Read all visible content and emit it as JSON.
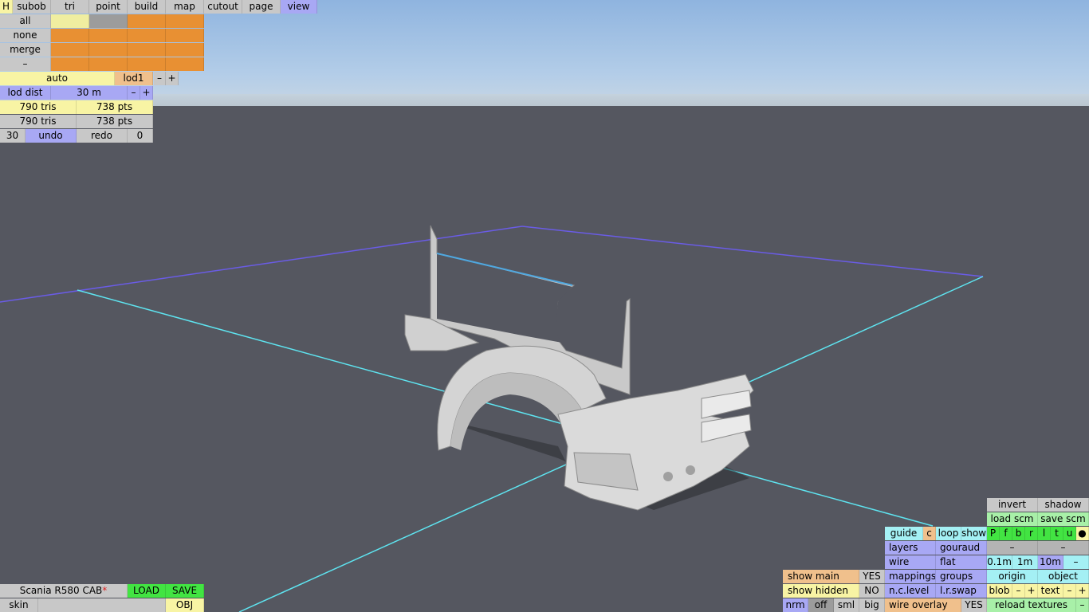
{
  "top_tabs": [
    "H",
    "subob",
    "tri",
    "point",
    "build",
    "map",
    "cutout",
    "page",
    "view"
  ],
  "select_rows": [
    "all",
    "none",
    "merge",
    "–"
  ],
  "lod": {
    "auto": "auto",
    "level": "lod1",
    "minus": "–",
    "plus": "+"
  },
  "lod_dist": {
    "label": "lod dist",
    "value": "30 m",
    "minus": "–",
    "plus": "+"
  },
  "stats": [
    {
      "tris": "790 tris",
      "pts": "738 pts"
    },
    {
      "tris": "790 tris",
      "pts": "738 pts"
    }
  ],
  "undo_row": {
    "count": "30",
    "undo": "undo",
    "redo": "redo",
    "redo_count": "0"
  },
  "file": {
    "name": "Scania R580 CAB",
    "modified_mark": "*",
    "load": "LOAD",
    "save": "SAVE",
    "skin": "skin",
    "skin_value": "",
    "obj": "OBJ"
  },
  "bottom_toggles": [
    {
      "label": "show main",
      "value": "YES"
    },
    {
      "label": "show hidden",
      "value": "NO"
    }
  ],
  "normals": [
    "nrm",
    "off",
    "sml",
    "big"
  ],
  "right_panel": {
    "invert": "invert",
    "shadow": "shadow",
    "load_scm": "load scm",
    "save_scm": "save scm",
    "guide": "guide",
    "c": "c",
    "loop": "loop",
    "show": "show",
    "flags": [
      "P",
      "f",
      "b",
      "r",
      "l",
      "t",
      "u",
      "●"
    ],
    "layers": "layers",
    "gouraud": "gouraud",
    "dash1": "–",
    "dash2": "–",
    "wire": "wire",
    "flat": "flat",
    "scale": [
      "0.1m",
      "1m",
      "10m"
    ],
    "scale_minus": "–",
    "mappings": "mappings",
    "groups": "groups",
    "origin": "origin",
    "object": "object",
    "nc_level": "n.c.level",
    "lr_swap": "l.r.swap",
    "blob": "blob",
    "blob_minus": "–",
    "blob_plus": "+",
    "text": "text",
    "text_minus": "–",
    "text_plus": "+",
    "wire_overlay": "wire overlay",
    "wire_overlay_value": "YES",
    "reload_textures": "reload textures",
    "reload_minus": "–"
  },
  "colors": {
    "sky": "#a9c6e6",
    "ground": "#555760",
    "grid_far": "#6a5ce6",
    "grid_near": "#5ee4f0",
    "model": "#cfcfcf"
  }
}
